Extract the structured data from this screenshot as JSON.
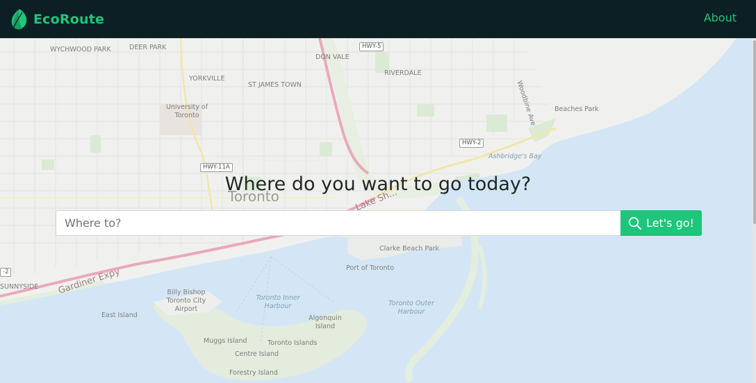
{
  "app": {
    "name": "EcoRoute",
    "nav_about": "About"
  },
  "hero": {
    "title": "Where do you want to go today?"
  },
  "search": {
    "placeholder": "Where to?",
    "value": "",
    "button_label": "Let's go!"
  },
  "map": {
    "labels": {
      "wychwood": "WYCHWOOD PARK",
      "deer_park": "DEER PARK",
      "don_vale": "DON VALE",
      "riverdale": "RIVERDALE",
      "yorkville": "YORKVILLE",
      "st_james": "ST JAMES TOWN",
      "uoft": "University of Toronto",
      "toronto": "Toronto",
      "lake_shore": "Lake Sh...",
      "woodbine": "Woodbine Ave",
      "beaches": "Beaches Park",
      "ashbridge": "Ashbridge's Bay",
      "clarke": "Clarke Beach Park",
      "port": "Port of Toronto",
      "gardiner": "Gardiner Expy",
      "sunnyside": "SUNNYSIDE",
      "billy_bishop": "Billy Bishop Toronto City Airport",
      "inner_harbour": "Toronto Inner Harbour",
      "outer_harbour": "Toronto Outer Harbour",
      "algonquin": "Algonquin Island",
      "east_island": "East Island",
      "muggs": "Muggs Island",
      "centre": "Centre Island",
      "toronto_islands": "Toronto Islands",
      "forestry": "Forestry Island"
    },
    "shields": {
      "hwy5": "HWY-5",
      "hwy2": "HWY-2",
      "hwy11a": "HWY-11A",
      "hwy2_west": "-2"
    }
  },
  "colors": {
    "accent": "#1ec67a",
    "navbar": "#0b1f24",
    "water": "#d4e6f5",
    "land": "#f0f1ee"
  }
}
